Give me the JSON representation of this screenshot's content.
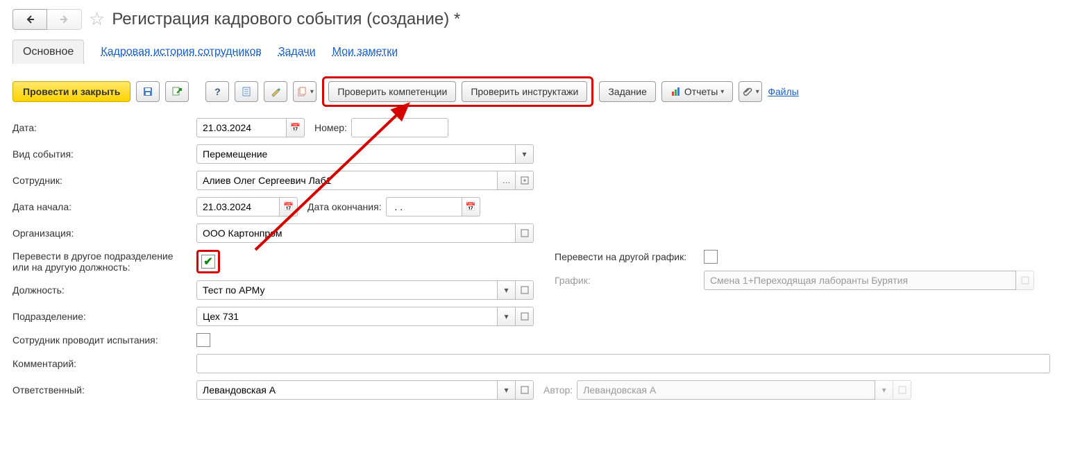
{
  "title": "Регистрация кадрового события (создание) *",
  "tabs": {
    "main": "Основное",
    "history": "Кадровая история сотрудников",
    "tasks": "Задачи",
    "notes": "Мои заметки"
  },
  "toolbar": {
    "post_close": "Провести и закрыть",
    "check_competencies": "Проверить компетенции",
    "check_instructions": "Проверить инструктажи",
    "task": "Задание",
    "reports": "Отчеты",
    "files": "Файлы"
  },
  "fields": {
    "date_lbl": "Дата:",
    "date_val": "21.03.2024",
    "number_lbl": "Номер:",
    "number_val": "",
    "event_type_lbl": "Вид события:",
    "event_type_val": "Перемещение",
    "employee_lbl": "Сотрудник:",
    "employee_val": "Алиев Олег Сергеевич Лаб1",
    "start_lbl": "Дата начала:",
    "start_val": "21.03.2024",
    "end_lbl": "Дата окончания:",
    "end_val": " . .",
    "org_lbl": "Организация:",
    "org_val": "ООО Картонпром",
    "transfer_dept_lbl": "Перевести в другое подразделение\nили на другую должность:",
    "transfer_sched_lbl": "Перевести на другой график:",
    "schedule_lbl": "График:",
    "schedule_val": "Смена 1+Переходящая лаборанты Бурятия",
    "position_lbl": "Должность:",
    "position_val": "Тест по АРМу",
    "dept_lbl": "Подразделение:",
    "dept_val": "Цех 731",
    "tests_lbl": "Сотрудник проводит испытания:",
    "comment_lbl": "Комментарий:",
    "comment_val": "",
    "responsible_lbl": "Ответственный:",
    "responsible_val": "Левандовская А",
    "author_lbl": "Автор:",
    "author_val": "Левандовская А"
  }
}
